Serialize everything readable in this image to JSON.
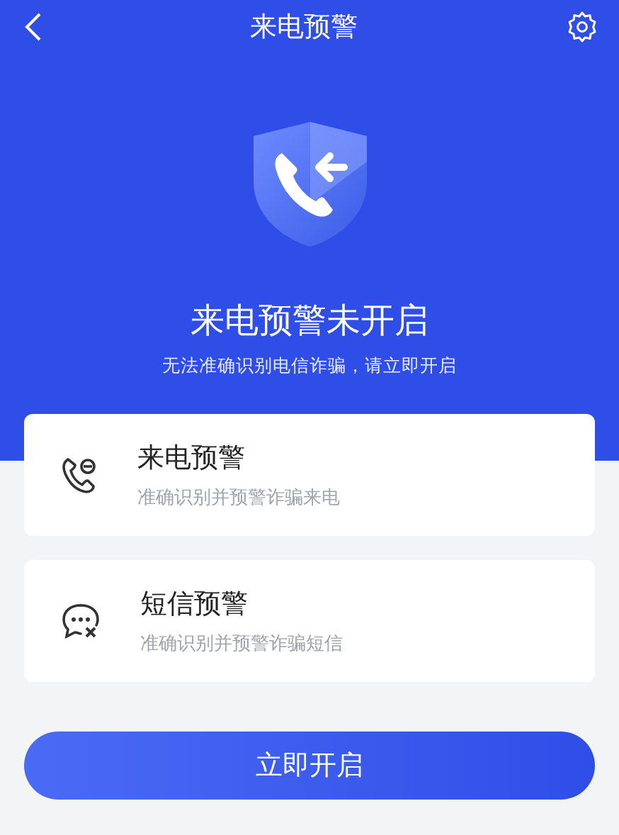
{
  "header": {
    "title": "来电预警"
  },
  "status": {
    "title": "来电预警未开启",
    "subtitle": "无法准确识别电信诈骗，请立即开启"
  },
  "features": [
    {
      "kind": "call",
      "title": "来电预警",
      "description": "准确识别并预警诈骗来电"
    },
    {
      "kind": "sms",
      "title": "短信预警",
      "description": "准确识别并预警诈骗短信"
    }
  ],
  "action_button": "立即开启"
}
